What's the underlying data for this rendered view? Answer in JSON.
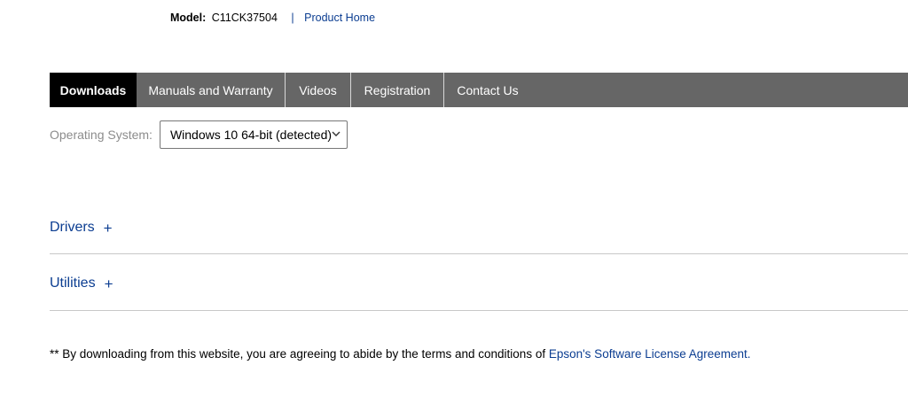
{
  "header": {
    "model_label": "Model:",
    "model_value": "C11CK37504",
    "separator": "|",
    "product_home": "Product Home"
  },
  "tabs": [
    {
      "label": "Downloads",
      "active": true
    },
    {
      "label": "Manuals and Warranty",
      "active": false
    },
    {
      "label": "Videos",
      "active": false
    },
    {
      "label": "Registration",
      "active": false
    },
    {
      "label": "Contact Us",
      "active": false
    }
  ],
  "os_selector": {
    "label": "Operating System:",
    "selected": "Windows 10 64-bit (detected)",
    "icon": "chevron-down-icon"
  },
  "sections": [
    {
      "label": "Drivers",
      "expand_symbol": "+"
    },
    {
      "label": "Utilities",
      "expand_symbol": "+"
    }
  ],
  "disclaimer": {
    "text": "** By downloading from this website, you are agreeing to abide by the terms and conditions of ",
    "link": "Epson's Software License Agreement."
  },
  "colors": {
    "tab_bar": "#666666",
    "tab_active": "#000000",
    "link": "#0b3d91"
  }
}
